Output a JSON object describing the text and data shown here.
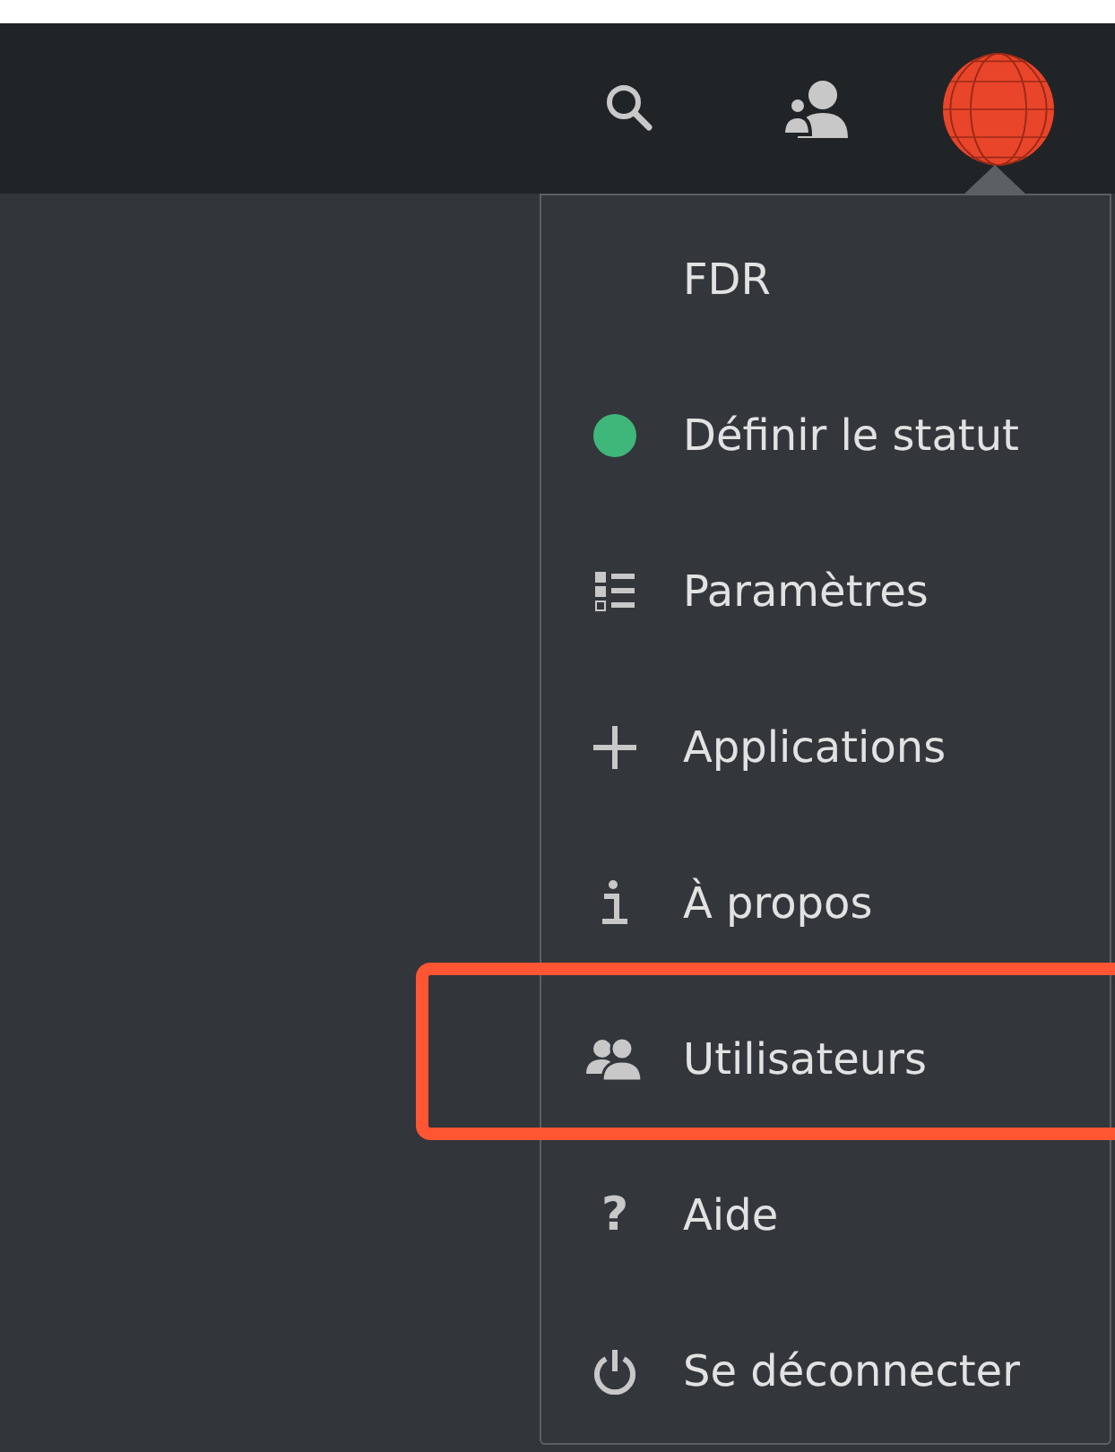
{
  "header": {
    "icons": [
      {
        "kind": "search"
      },
      {
        "kind": "contacts"
      },
      {
        "kind": "avatar"
      }
    ]
  },
  "menu": {
    "items": [
      {
        "kind": "name",
        "label": "FDR",
        "highlighted": false
      },
      {
        "kind": "status",
        "label": "Définir le statut",
        "color": "#3fb77a",
        "highlighted": false
      },
      {
        "kind": "settings",
        "label": "Paramètres",
        "highlighted": false
      },
      {
        "kind": "add",
        "label": "Applications",
        "highlighted": false
      },
      {
        "kind": "info",
        "label": "À propos",
        "highlighted": false
      },
      {
        "kind": "users",
        "label": "Utilisateurs",
        "highlighted": true
      },
      {
        "kind": "help",
        "icon_text": "?",
        "label": "Aide",
        "highlighted": false
      },
      {
        "kind": "logout",
        "label": "Se déconnecter",
        "highlighted": false
      }
    ]
  }
}
